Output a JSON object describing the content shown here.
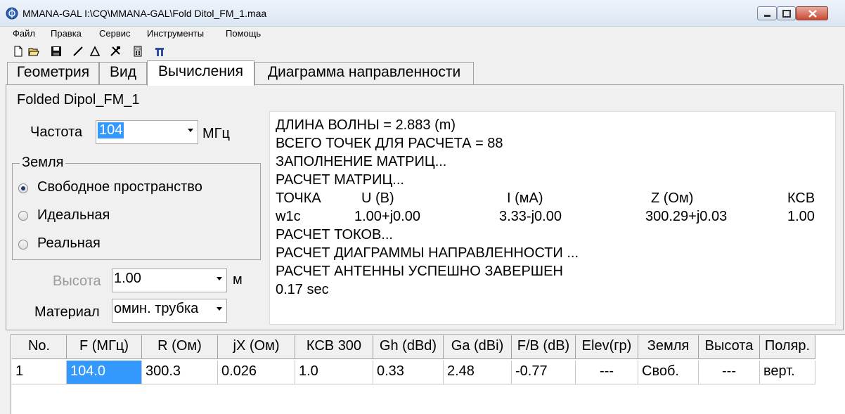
{
  "window": {
    "title": "MMANA-GAL I:\\CQ\\MMANA-GAL\\Fold Ditol_FM_1.maa"
  },
  "menu": [
    "Файл",
    "Правка",
    "Сервис",
    "Инструменты",
    "Помощь"
  ],
  "toolbar_icons": [
    "new-file-icon",
    "open-folder-icon",
    "save-icon",
    "draw-wire-icon",
    "triangle-icon",
    "tools-icon",
    "calculator-icon",
    "antenna-icon"
  ],
  "tabs": [
    {
      "label": "Геометрия",
      "active": false
    },
    {
      "label": "Вид",
      "active": false
    },
    {
      "label": "Вычисления",
      "active": true
    },
    {
      "label": "Диаграмма направленности",
      "active": false
    }
  ],
  "calc": {
    "antenna_name": "Folded Dipol_FM_1",
    "frequency_label": "Частота",
    "frequency_value": "104",
    "frequency_unit": "МГц",
    "ground_group_label": "Земля",
    "ground_options": [
      {
        "label": "Свободное пространство",
        "checked": true
      },
      {
        "label": "Идеальная",
        "checked": false
      },
      {
        "label": "Реальная",
        "checked": false
      }
    ],
    "height_label": "Высота",
    "height_value": "1.00",
    "height_unit": "м",
    "material_label": "Материал",
    "material_value": "омин. трубка"
  },
  "output": {
    "lines_top": [
      "ДЛИНА ВОЛНЫ = 2.883 (m)",
      "ВСЕГО ТОЧЕК ДЛЯ РАСЧЕТА = 88",
      "ЗАПОЛНЕНИЕ МАТРИЦ...",
      "РАСЧЕТ МАТРИЦ..."
    ],
    "table_header": [
      "ТОЧКА",
      "U (B)",
      "I (мА)",
      "Z (Ом)",
      "КСВ"
    ],
    "table_row": [
      "w1c",
      "1.00+j0.00",
      "3.33-j0.00",
      "300.29+j0.03",
      "1.00"
    ],
    "lines_bottom": [
      "РАСЧЕТ ТОКОВ...",
      "РАСЧЕТ ДИАГРАММЫ НАПРАВЛЕННОСТИ ...",
      "РАСЧЕТ АНТЕННЫ УСПЕШНО ЗАВЕРШЕН",
      "0.17 sec"
    ]
  },
  "results": {
    "columns": [
      "No.",
      "F (МГц)",
      "R (Ом)",
      "jX (Ом)",
      "КСВ 300",
      "Gh (dBd)",
      "Ga (dBi)",
      "F/B (dB)",
      "Elev(гр)",
      "Земля",
      "Высота",
      "Поляр."
    ],
    "rows": [
      [
        "1",
        "104.0",
        "300.3",
        "0.026",
        "1.0",
        "0.33",
        "2.48",
        "-0.77",
        "---",
        "Своб.",
        "---",
        "верт."
      ]
    ]
  }
}
